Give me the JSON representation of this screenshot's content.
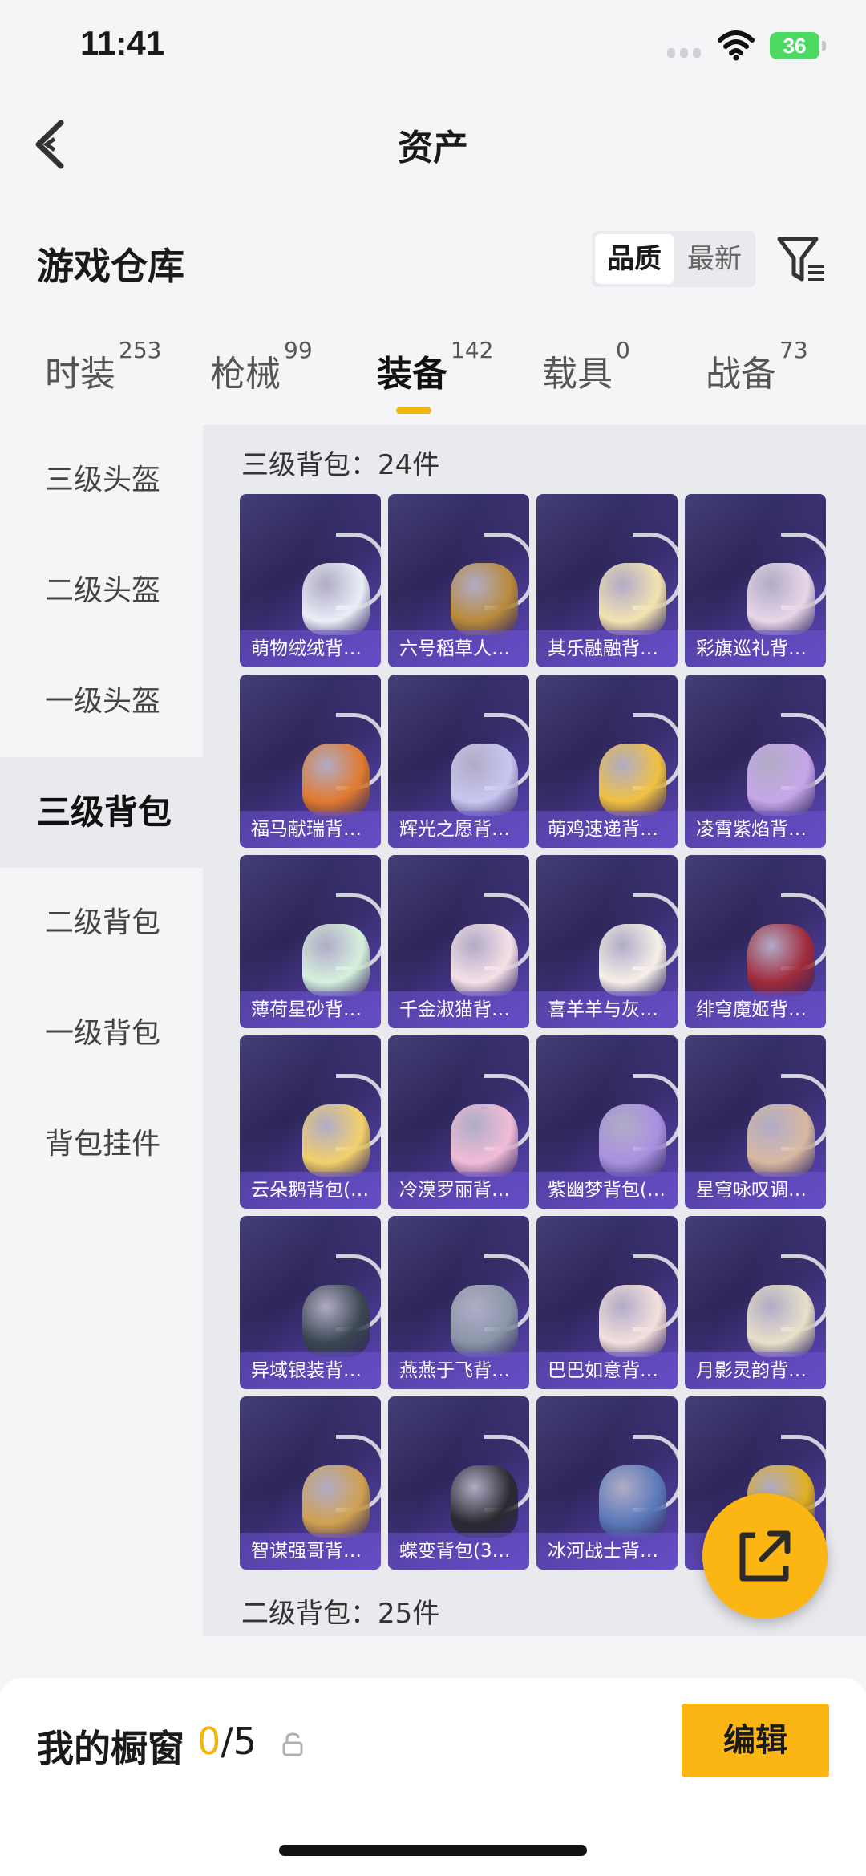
{
  "status_bar": {
    "time": "11:41",
    "battery": "36"
  },
  "nav": {
    "title": "资产"
  },
  "warehouse": {
    "title": "游戏仓库",
    "sort_options": [
      "品质",
      "最新"
    ],
    "active_sort": "品质"
  },
  "tabs": [
    {
      "label": "时装",
      "count": "253"
    },
    {
      "label": "枪械",
      "count": "99"
    },
    {
      "label": "装备",
      "count": "142"
    },
    {
      "label": "载具",
      "count": "0"
    },
    {
      "label": "战备",
      "count": "73"
    }
  ],
  "active_tab": "装备",
  "categories": [
    {
      "label": "三级头盔"
    },
    {
      "label": "二级头盔"
    },
    {
      "label": "一级头盔"
    },
    {
      "label": "三级背包"
    },
    {
      "label": "二级背包"
    },
    {
      "label": "一级背包"
    },
    {
      "label": "背包挂件"
    }
  ],
  "active_category": "三级背包",
  "groups": {
    "level3": {
      "title": "三级背包：24件"
    },
    "level2": {
      "title": "二级背包：25件"
    }
  },
  "items": [
    {
      "label": "萌物绒绒背…",
      "color": "#e9eef6"
    },
    {
      "label": "六号稻草人…",
      "color": "#b88a3a"
    },
    {
      "label": "其乐融融背…",
      "color": "#f3e3b0"
    },
    {
      "label": "彩旗巡礼背…",
      "color": "#e8d6e8"
    },
    {
      "label": "福马献瑞背…",
      "color": "#e07a2e"
    },
    {
      "label": "辉光之愿背…",
      "color": "#c8c6f0"
    },
    {
      "label": "萌鸡速递背…",
      "color": "#f0c040"
    },
    {
      "label": "凌霄紫焰背…",
      "color": "#c6a6e8"
    },
    {
      "label": "薄荷星砂背…",
      "color": "#d6f0dc"
    },
    {
      "label": "千金淑猫背…",
      "color": "#f6e0e6"
    },
    {
      "label": "喜羊羊与灰…",
      "color": "#f6efe8"
    },
    {
      "label": "绯穹魔姬背…",
      "color": "#a02a3a"
    },
    {
      "label": "云朵鹅背包(…",
      "color": "#f2d06a"
    },
    {
      "label": "冷漠罗丽背…",
      "color": "#f0bcd6"
    },
    {
      "label": "紫幽梦背包(…",
      "color": "#a890e0"
    },
    {
      "label": "星穹咏叹调…",
      "color": "#d8b8a0"
    },
    {
      "label": "异域银装背…",
      "color": "#3a4650"
    },
    {
      "label": "燕燕于飞背…",
      "color": "#8a96a8"
    },
    {
      "label": "巴巴如意背…",
      "color": "#f4e0dc"
    },
    {
      "label": "月影灵韵背…",
      "color": "#e8e0c8"
    },
    {
      "label": "智谋强哥背…",
      "color": "#d0a050"
    },
    {
      "label": "蝶变背包(3…",
      "color": "#2a2a30"
    },
    {
      "label": "冰河战士背…",
      "color": "#5a78b8"
    },
    {
      "label": "",
      "color": "#e0b020"
    }
  ],
  "showcase": {
    "title": "我的橱窗",
    "used": "0",
    "total": "/5",
    "edit_label": "编辑"
  },
  "colors": {
    "accent": "#fbb614",
    "card_bg": "#2d2658",
    "label_bg": "#6e54d2"
  }
}
